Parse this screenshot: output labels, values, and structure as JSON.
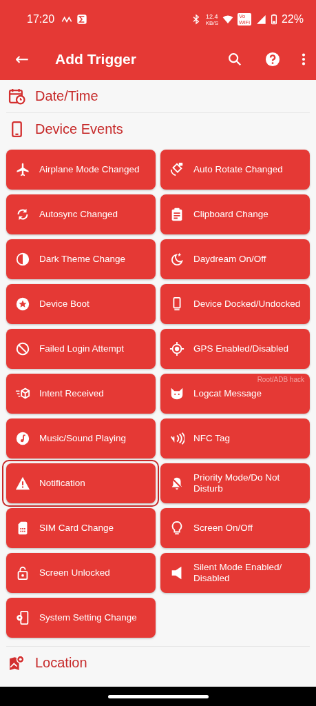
{
  "status_bar": {
    "time": "17:20",
    "net_speed": "12.4",
    "net_unit": "KB/S",
    "volte_top": "Vo",
    "volte_bottom": "WiFi",
    "battery": "22%"
  },
  "app_bar": {
    "back": "←",
    "title": "Add Trigger"
  },
  "sections": [
    {
      "title": "Date/Time",
      "expanded": false
    },
    {
      "title": "Device Events",
      "expanded": true
    }
  ],
  "triggers": [
    {
      "label": "Airplane Mode Changed",
      "highlighted": false
    },
    {
      "label": "Auto Rotate Changed",
      "highlighted": false
    },
    {
      "label": "Autosync Changed",
      "highlighted": false
    },
    {
      "label": "Clipboard Change",
      "highlighted": false
    },
    {
      "label": "Dark Theme Change",
      "highlighted": false
    },
    {
      "label": "Daydream On/Off",
      "highlighted": false
    },
    {
      "label": "Device Boot",
      "highlighted": false
    },
    {
      "label": "Device Docked/Undocked",
      "highlighted": false
    },
    {
      "label": "Failed Login Attempt",
      "highlighted": false
    },
    {
      "label": "GPS Enabled/Disabled",
      "highlighted": false
    },
    {
      "label": "Intent Received",
      "highlighted": false
    },
    {
      "label": "Logcat Message",
      "highlighted": false,
      "root_hack": true
    },
    {
      "label": "Music/Sound Playing",
      "highlighted": false
    },
    {
      "label": "NFC Tag",
      "highlighted": false
    },
    {
      "label": "Notification",
      "highlighted": true
    },
    {
      "label": "Priority Mode/Do Not Disturb",
      "highlighted": false
    },
    {
      "label": "SIM Card Change",
      "highlighted": false
    },
    {
      "label": "Screen On/Off",
      "highlighted": false
    },
    {
      "label": "Screen Unlocked",
      "highlighted": false
    },
    {
      "label": "Silent Mode Enabled/ Disabled",
      "highlighted": false
    },
    {
      "label": "System Setting Change",
      "highlighted": false
    }
  ],
  "root_hack_note": "Root/ADB hack",
  "footer_section": {
    "title": "Location"
  }
}
